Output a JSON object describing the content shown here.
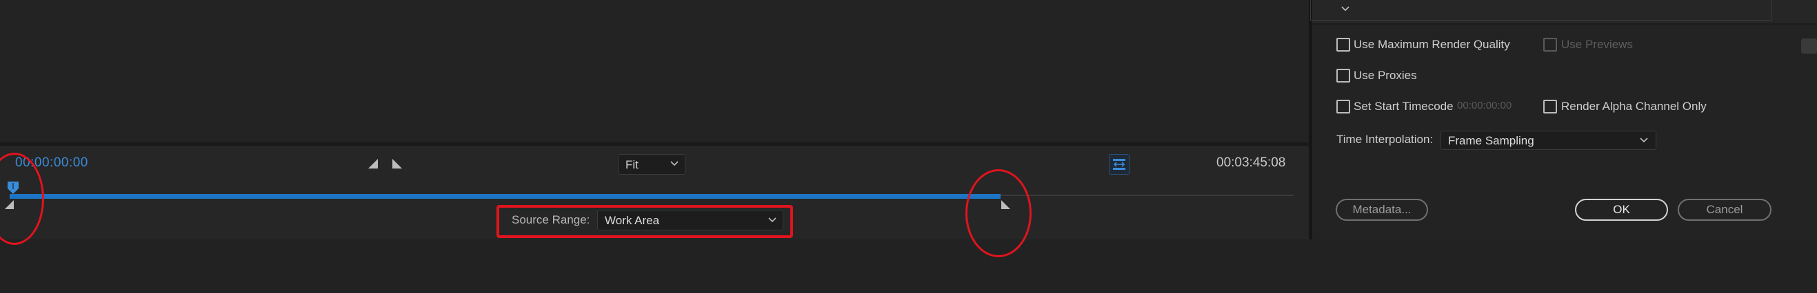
{
  "preview": {
    "timecode_in": "00:00:00:00",
    "timecode_out": "00:03:45:08",
    "zoom_value": "Fit",
    "source_range_label": "Source Range:",
    "source_range_value": "Work Area",
    "range_fill_fraction": 0.772
  },
  "settings": {
    "use_max_render_quality": "Use Maximum Render Quality",
    "use_previews": "Use Previews",
    "use_proxies": "Use Proxies",
    "set_start_timecode": "Set Start Timecode",
    "start_timecode_value": "00:00:00:00",
    "render_alpha_only": "Render Alpha Channel Only",
    "time_interpolation_label": "Time Interpolation:",
    "time_interpolation_value": "Frame Sampling",
    "metadata_button": "Metadata...",
    "ok_button": "OK",
    "cancel_button": "Cancel"
  },
  "colors": {
    "accent_blue": "#1d74c4",
    "annotation_red": "#e0141e"
  }
}
